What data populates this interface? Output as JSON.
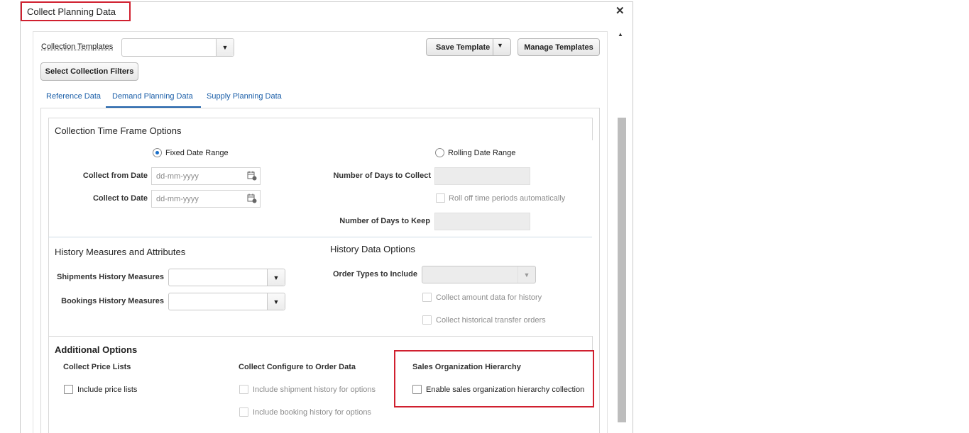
{
  "dialog": {
    "title": "Collect Planning Data",
    "close_icon": "close-icon",
    "highlight_color": "#d0202f"
  },
  "toolbar": {
    "templates_label": "Collection Templates",
    "templates_value": "",
    "save_template_label": "Save Template",
    "manage_templates_label": "Manage Templates",
    "select_filters_label": "Select Collection Filters"
  },
  "tabs": [
    {
      "label": "Reference Data",
      "active": false
    },
    {
      "label": "Demand Planning Data",
      "active": true
    },
    {
      "label": "Supply Planning Data",
      "active": false
    }
  ],
  "time_frame": {
    "title": "Collection Time Frame Options",
    "fixed_label": "Fixed Date Range",
    "rolling_label": "Rolling Date Range",
    "selected": "Fixed Date Range",
    "from_label": "Collect from Date",
    "to_label": "Collect to Date",
    "date_placeholder": "dd-mm-yyyy",
    "days_collect_label": "Number of Days to Collect",
    "roll_off_label": "Roll off time periods automatically",
    "days_keep_label": "Number of Days to Keep"
  },
  "history": {
    "title": "History Measures and Attributes",
    "shipments_label": "Shipments History Measures",
    "bookings_label": "Bookings History Measures",
    "options_title": "History Data Options",
    "order_types_label": "Order Types to Include",
    "amount_label": "Collect amount data for history",
    "transfer_label": "Collect historical transfer orders"
  },
  "additional": {
    "title": "Additional Options",
    "price_title": "Collect Price Lists",
    "price_check_label": "Include price lists",
    "cto_title": "Collect Configure to Order Data",
    "cto_shipment_label": "Include shipment history for options",
    "cto_booking_label": "Include booking history for options",
    "sales_title": "Sales Organization Hierarchy",
    "sales_check_label": "Enable sales organization hierarchy collection"
  },
  "colors": {
    "accent": "#1a5ea8",
    "radio_selected": "#1a6fc9",
    "scrollbar_thumb": "#bdbdbd"
  }
}
